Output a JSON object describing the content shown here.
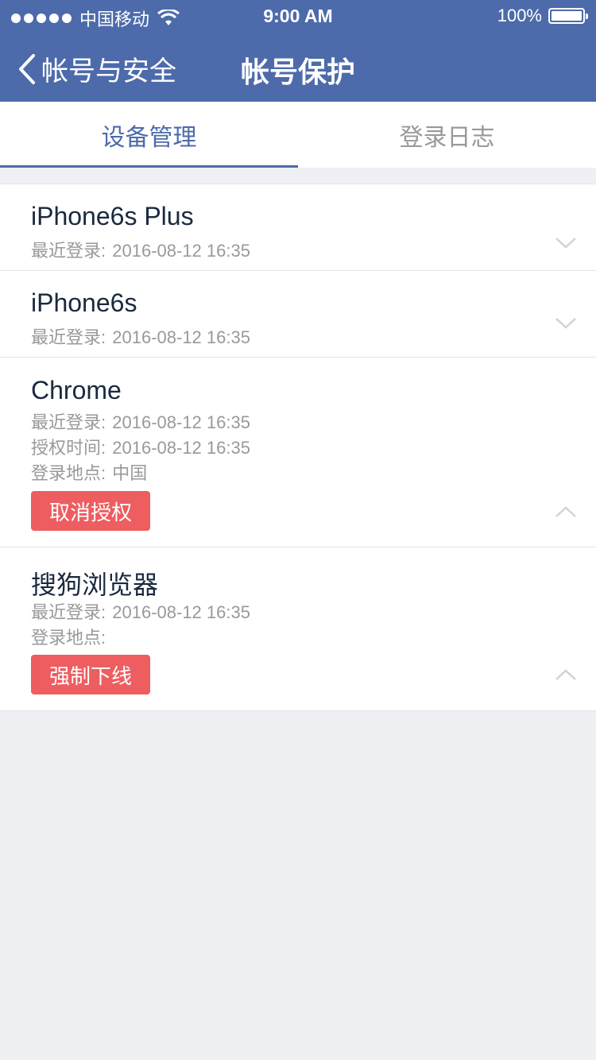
{
  "status_bar": {
    "carrier": "中国移动",
    "time": "9:00 AM",
    "battery": "100%",
    "battery_level": 1.0
  },
  "nav": {
    "back_label": "帐号与安全",
    "title": "帐号保护"
  },
  "tabs": [
    {
      "label": "设备管理",
      "active": true
    },
    {
      "label": "登录日志",
      "active": false
    }
  ],
  "colors": {
    "accent": "#4d6bab",
    "title_text": "#1A293E",
    "secondary_text": "#999999",
    "danger_button": "#ee5d60",
    "background": "#eef0f4"
  },
  "devices": [
    {
      "name": "iPhone6s Plus",
      "last_login_label": "最近登录:",
      "last_login_value": "2016-08-12 16:35",
      "expanded": false,
      "chevron_icon": "chevron-down-icon"
    },
    {
      "name": "iPhone6s",
      "last_login_label": "最近登录:",
      "last_login_value": "2016-08-12 16:35",
      "expanded": false,
      "chevron_icon": "chevron-down-icon"
    },
    {
      "name": "Chrome",
      "last_login_label": "最近登录:",
      "last_login_value": "2016-08-12 16:35",
      "auth_time_label": "授权时间:",
      "auth_time_value": "2016-08-12 16:35",
      "location_label": "登录地点:",
      "location_value": "中国",
      "action_label": "取消授权",
      "expanded": true,
      "chevron_icon": "chevron-up-icon"
    },
    {
      "name": "搜狗浏览器",
      "last_login_label": "最近登录:",
      "last_login_value": "2016-08-12 16:35",
      "location_label": "登录地点:",
      "location_value": "",
      "action_label": "强制下线",
      "expanded": true,
      "chevron_icon": "chevron-up-icon"
    }
  ]
}
